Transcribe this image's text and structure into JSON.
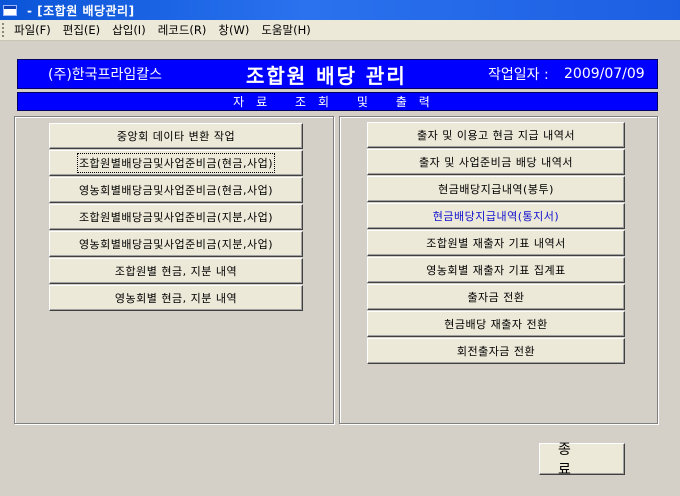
{
  "window": {
    "title": "- [조합원 배당관리]"
  },
  "menu": [
    "파일(F)",
    "편집(E)",
    "삽입(I)",
    "레코드(R)",
    "창(W)",
    "도움말(H)"
  ],
  "header": {
    "company": "(주)한국프라임칼스",
    "title": "조합원 배당 관리",
    "date_label": "작업일자 :",
    "date_value": "2009/07/09"
  },
  "subtitle": "자료 조회 및 출력",
  "left_buttons": [
    "중앙회 데이타 변환 작업",
    "조합원별배당금및사업준비금(현금,사업)",
    "영농회별배당금및사업준비금(현금,사업)",
    "조합원별배당금및사업준비금(지분,사업)",
    "영농회별배당금및사업준비금(지분,사업)",
    "조합원별 현금, 지분 내역",
    "영농회별 현금, 지분 내역"
  ],
  "right_buttons": [
    "출자 및 이용고 현금 지급 내역서",
    "출자 및 사업준비금 배당 내역서",
    "현금배당지급내역(봉투)",
    "현금배당지급내역(통지서)",
    "조합원별 재출자 기표 내역서",
    "영농회별 재출자 기표 집계표",
    "출자금 전환",
    "현금배당 재출자 전환",
    "회전출자금 전환"
  ],
  "exit_button": "종 료",
  "colors": {
    "header_bg": "#0000ff",
    "highlight_text": "#1010d0"
  }
}
